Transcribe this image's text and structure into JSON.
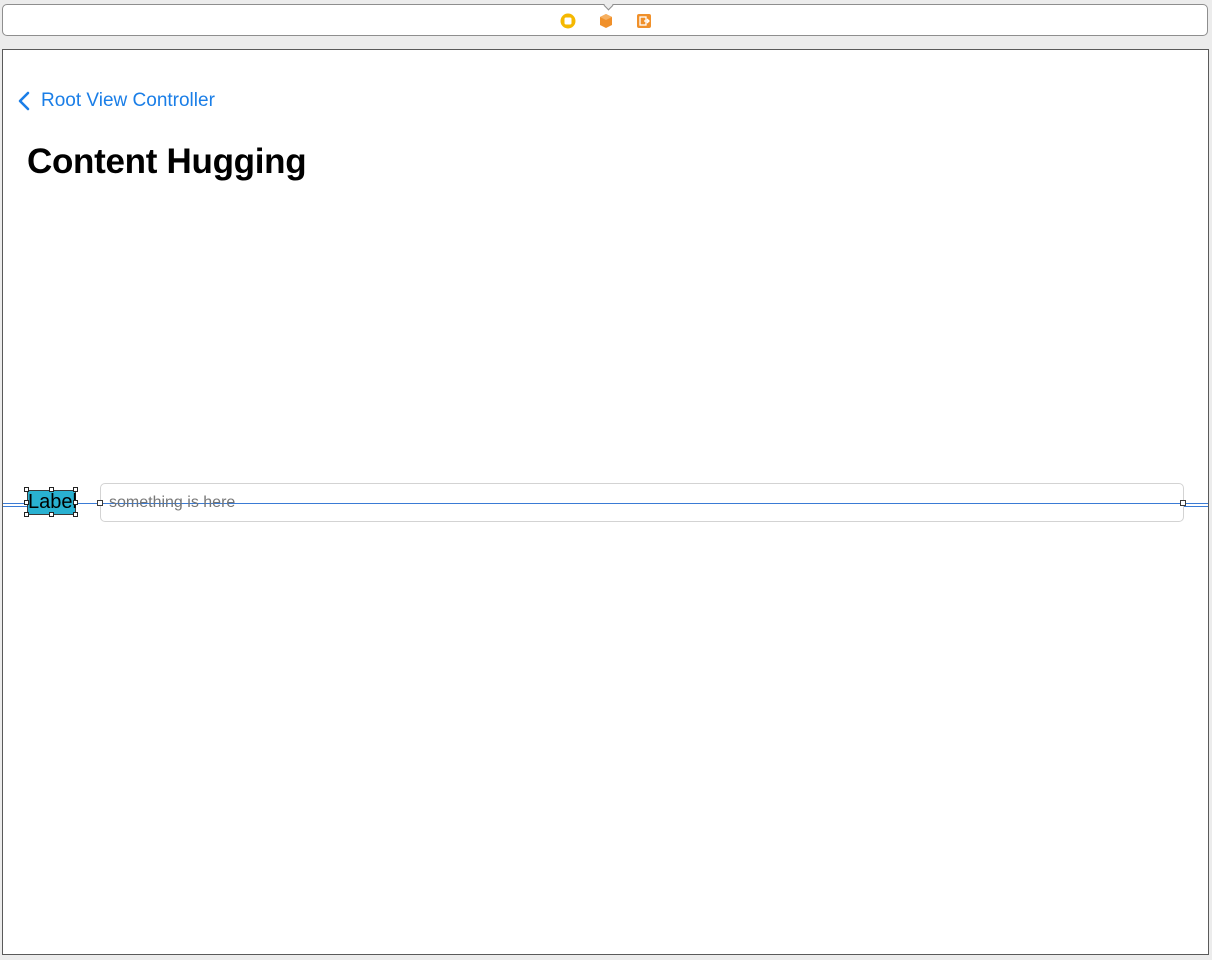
{
  "scene_dock": {
    "icons": [
      "view-controller-icon",
      "first-responder-icon",
      "exit-icon"
    ],
    "colors": {
      "view_controller": "#f5b800",
      "first_responder": "#f0902a",
      "exit": "#f0902a"
    }
  },
  "navigation_bar": {
    "back_label": "Root View Controller",
    "back_icon": "chevron-left-icon",
    "title": "Content Hugging",
    "accent": "#1a7ee7"
  },
  "content": {
    "label_text": "Label",
    "label_background": "#29b1d1",
    "text_field": {
      "value": "",
      "placeholder": "something is here"
    },
    "constraint_color": "#3a7bd5"
  }
}
